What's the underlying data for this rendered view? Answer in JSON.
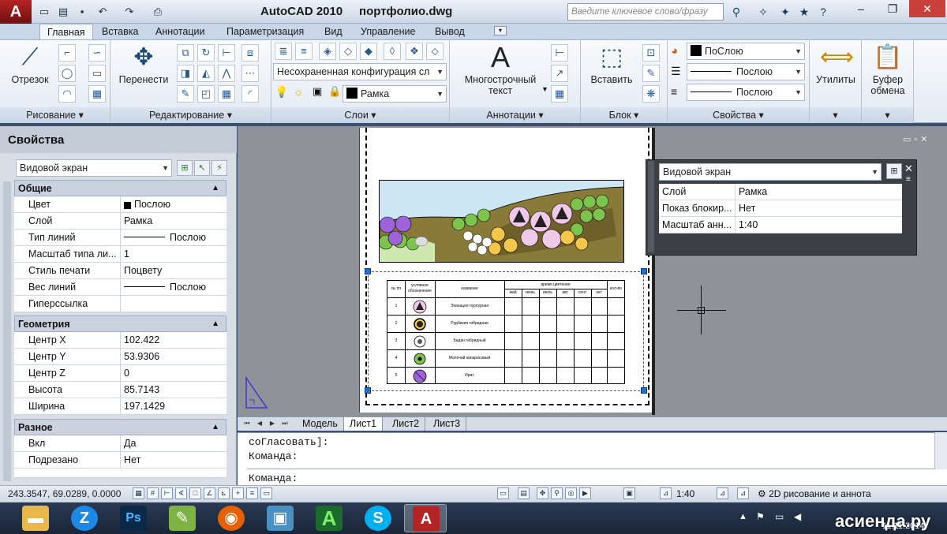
{
  "titlebar": {
    "logo": "A",
    "title": "AutoCAD 2010     портфолио.dwg",
    "search_placeholder": "Введите ключевое слово/фразу"
  },
  "tabs": [
    "Главная",
    "Вставка",
    "Аннотации",
    "Параметризация",
    "Вид",
    "Управление",
    "Вывод"
  ],
  "ribbon": {
    "draw": {
      "title": "Рисование",
      "line": "Отрезок"
    },
    "modify": {
      "title": "Редактирование",
      "move": "Перенести"
    },
    "layers": {
      "title": "Слои",
      "state": "Несохраненная конфигурация сл",
      "layer": "Рамка"
    },
    "annot": {
      "title": "Аннотации",
      "mtext1": "Многострочный",
      "mtext2": "текст",
      "big_glyph": "A"
    },
    "block": {
      "title": "Блок",
      "insert": "Вставить"
    },
    "props": {
      "title": "Свойства",
      "color": "ПоСлою",
      "lineweight": "Послою",
      "linetype": "Послою"
    },
    "utils": {
      "label": "Утилиты"
    },
    "clip": {
      "label1": "Буфер",
      "label2": "обмена"
    }
  },
  "palette": {
    "title": "Свойства",
    "object": "Видовой экран",
    "general": {
      "title": "Общие",
      "rows": [
        [
          "Цвет",
          "Послою"
        ],
        [
          "Слой",
          "Рамка"
        ],
        [
          "Тип линий",
          "Послою"
        ],
        [
          "Масштаб типа ли...",
          "1"
        ],
        [
          "Стиль печати",
          "Поцвету"
        ],
        [
          "Вес линий",
          "Послою"
        ],
        [
          "Гиперссылка",
          ""
        ]
      ]
    },
    "geometry": {
      "title": "Геометрия",
      "rows": [
        [
          "Центр X",
          "102.422"
        ],
        [
          "Центр Y",
          "53.9306"
        ],
        [
          "Центр Z",
          "0"
        ],
        [
          "Высота",
          "85.7143"
        ],
        [
          "Ширина",
          "197.1429"
        ]
      ]
    },
    "misc": {
      "title": "Разное",
      "rows": [
        [
          "Вкл",
          "Да"
        ],
        [
          "Подрезано",
          "Нет"
        ]
      ]
    }
  },
  "popup": {
    "object": "Видовой экран",
    "rows": [
      [
        "Слой",
        "Рамка"
      ],
      [
        "Показ блокир...",
        "Нет"
      ],
      [
        "Масштаб анн...",
        "1:40"
      ]
    ]
  },
  "table": {
    "h_num": "№ пп",
    "h_symbol1": "условное",
    "h_symbol2": "обозначение",
    "h_name": "название",
    "h_bloom": "время цветения",
    "h_qty": "кол-во",
    "months": [
      "май",
      "июнь",
      "июль",
      "авг",
      "сент",
      "окт"
    ],
    "rows": [
      [
        "1",
        "Эхинацея пурпурная"
      ],
      [
        "2",
        "Рудбекия гибридная"
      ],
      [
        "3",
        "Бадан гибридный"
      ],
      [
        "4",
        "Молочай кипарисовый"
      ],
      [
        "5",
        "Ирис"
      ]
    ]
  },
  "layout_tabs": [
    "Модель",
    "Лист1",
    "Лист2",
    "Лист3"
  ],
  "command": {
    "line1": "соГласовать]:",
    "line2": "Команда:",
    "line3": "Команда:"
  },
  "status": {
    "coords": "243.3547, 69.0289, 0.0000",
    "scale": "1:40",
    "workspace": "2D рисование и аннота"
  },
  "taskbar": {
    "watermark": "асиенда.ру",
    "date": "11.11.2014"
  },
  "colors": {
    "accent": "#1f6fd6",
    "autocad_red": "#b52424",
    "canvas": "#8f9298"
  }
}
